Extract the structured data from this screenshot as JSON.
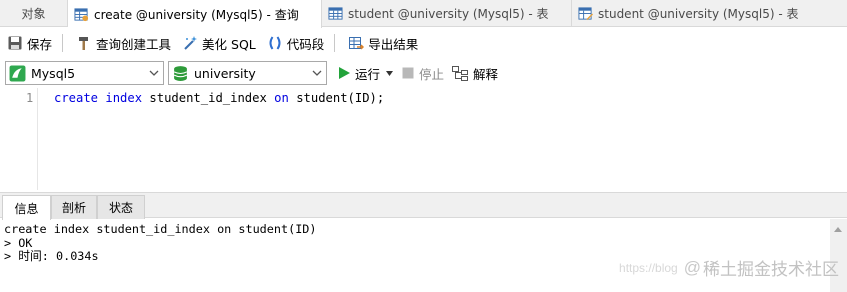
{
  "tabs": {
    "objects": "对象",
    "active": "create @university (Mysql5) - 查询",
    "tab2": "student @university (Mysql5) - 表",
    "tab3": "student @university (Mysql5) - 表"
  },
  "toolbar": {
    "save": "保存",
    "query_builder": "查询创建工具",
    "beautify": "美化 SQL",
    "snippet": "代码段",
    "export": "导出结果"
  },
  "selectors": {
    "connection": "Mysql5",
    "database": "university",
    "run": "运行",
    "stop": "停止",
    "explain": "解释"
  },
  "editor": {
    "line_number": "1",
    "kw_create": "create",
    "kw_index": "index",
    "index_name": "student_id_index",
    "kw_on": "on",
    "target": "student(ID);"
  },
  "bottom_tabs": {
    "info": "信息",
    "profile": "剖析",
    "status": "状态"
  },
  "output": {
    "line1": "create index student_id_index on student(ID)",
    "line2": "> OK",
    "line3": "> 时间: 0.034s"
  },
  "watermark": {
    "blog": "https://blog",
    "brand": "稀土掘金技术社区"
  },
  "colors": {
    "keyword": "#0000e0",
    "run_icon": "#22a33a",
    "db_icon": "#2e9b3a"
  }
}
